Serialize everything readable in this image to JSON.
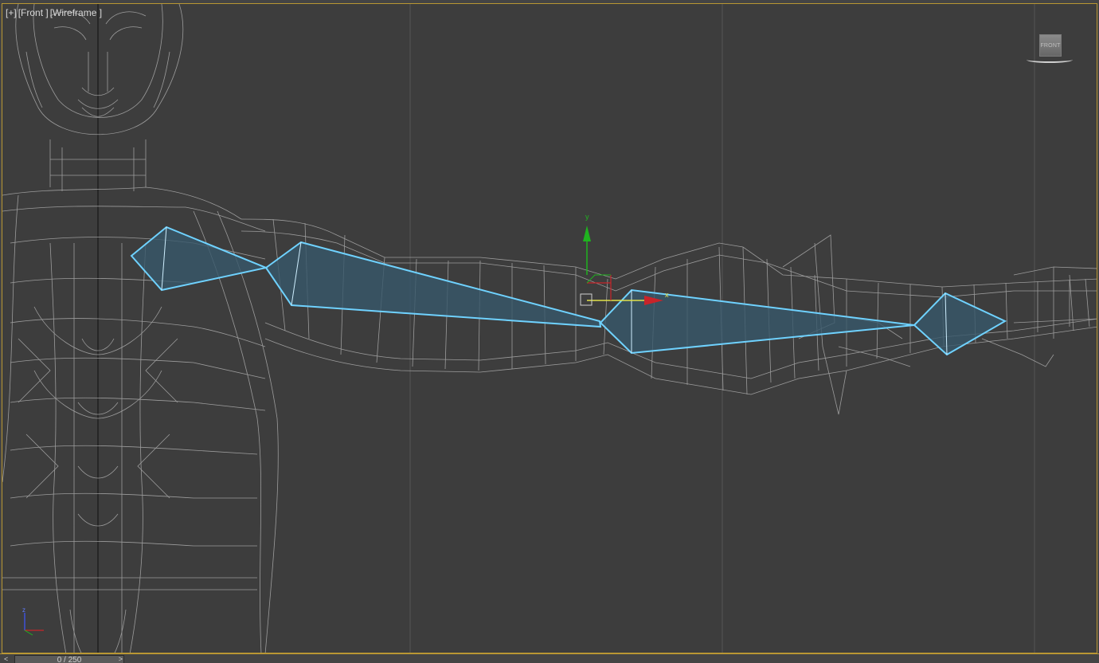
{
  "viewport": {
    "label_plus": "[+]",
    "label_view": "[Front ]",
    "label_shading": "[Wireframe ]",
    "viewcube_face": "FRONT",
    "gizmo_y": "y",
    "gizmo_x": "x",
    "axis_z": "z"
  },
  "timeline": {
    "frame_display": "0 / 250",
    "prev_label": "<",
    "next_label": ">"
  },
  "colors": {
    "frame_border": "#b99733",
    "background": "#3d3d3d",
    "wireframe": "#9c9c9c",
    "selection_highlight": "#6fd2ff",
    "bone_fill": "#37576a"
  }
}
